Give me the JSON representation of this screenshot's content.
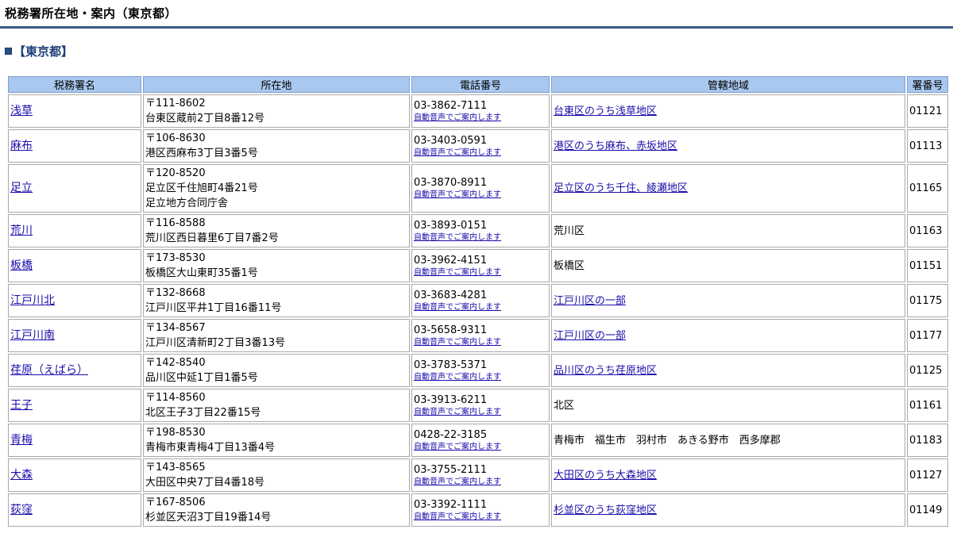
{
  "page": {
    "title": "税務署所在地・案内（東京都）",
    "section": "【東京都】"
  },
  "table": {
    "headers": [
      "税務署名",
      "所在地",
      "電話番号",
      "管轄地域",
      "署番号"
    ],
    "auto_voice_label": "自動音声でご案内します",
    "rows": [
      {
        "name": "浅草",
        "postal": "〒111-8602",
        "address": [
          "台東区蔵前2丁目8番12号"
        ],
        "phone": "03-3862-7111",
        "area": "台東区のうち浅草地区",
        "area_link": true,
        "code": "01121"
      },
      {
        "name": "麻布",
        "postal": "〒106-8630",
        "address": [
          "港区西麻布3丁目3番5号"
        ],
        "phone": "03-3403-0591",
        "area": "港区のうち麻布、赤坂地区",
        "area_link": true,
        "code": "01113"
      },
      {
        "name": "足立",
        "postal": "〒120-8520",
        "address": [
          "足立区千住旭町4番21号",
          "足立地方合同庁舎"
        ],
        "phone": "03-3870-8911",
        "area": "足立区のうち千住、綾瀬地区",
        "area_link": true,
        "code": "01165"
      },
      {
        "name": "荒川",
        "postal": "〒116-8588",
        "address": [
          "荒川区西日暮里6丁目7番2号"
        ],
        "phone": "03-3893-0151",
        "area": "荒川区",
        "area_link": false,
        "code": "01163"
      },
      {
        "name": "板橋",
        "postal": "〒173-8530",
        "address": [
          "板橋区大山東町35番1号"
        ],
        "phone": "03-3962-4151",
        "area": "板橋区",
        "area_link": false,
        "code": "01151"
      },
      {
        "name": "江戸川北",
        "postal": "〒132-8668",
        "address": [
          "江戸川区平井1丁目16番11号"
        ],
        "phone": "03-3683-4281",
        "area": "江戸川区の一部",
        "area_link": true,
        "code": "01175"
      },
      {
        "name": "江戸川南",
        "postal": "〒134-8567",
        "address": [
          "江戸川区清新町2丁目3番13号"
        ],
        "phone": "03-5658-9311",
        "area": "江戸川区の一部",
        "area_link": true,
        "code": "01177"
      },
      {
        "name": "荏原（えばら）",
        "postal": "〒142-8540",
        "address": [
          "品川区中延1丁目1番5号"
        ],
        "phone": "03-3783-5371",
        "area": "品川区のうち荏原地区",
        "area_link": true,
        "code": "01125"
      },
      {
        "name": "王子",
        "postal": "〒114-8560",
        "address": [
          "北区王子3丁目22番15号"
        ],
        "phone": "03-3913-6211",
        "area": "北区",
        "area_link": false,
        "code": "01161"
      },
      {
        "name": "青梅",
        "postal": "〒198-8530",
        "address": [
          "青梅市東青梅4丁目13番4号"
        ],
        "phone": "0428-22-3185",
        "area": "青梅市　福生市　羽村市　あきる野市　西多摩郡",
        "area_link": false,
        "code": "01183"
      },
      {
        "name": "大森",
        "postal": "〒143-8565",
        "address": [
          "大田区中央7丁目4番18号"
        ],
        "phone": "03-3755-2111",
        "area": "大田区のうち大森地区",
        "area_link": true,
        "code": "01127"
      },
      {
        "name": "荻窪",
        "postal": "〒167-8506",
        "address": [
          "杉並区天沼3丁目19番14号"
        ],
        "phone": "03-3392-1111",
        "area": "杉並区のうち荻窪地区",
        "area_link": true,
        "code": "01149"
      }
    ]
  }
}
